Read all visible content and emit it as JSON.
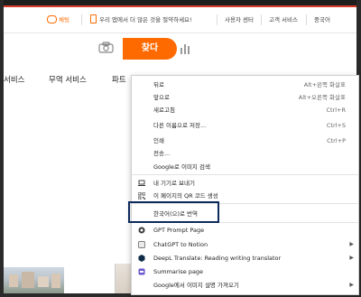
{
  "topbar": {
    "chat_label": "채팅",
    "promo_label": "우리 앱에서 더 많은 것을 절약하세요!",
    "seller_center": "사용자 센터",
    "customer_service": "고객 서비스",
    "language": "중국어"
  },
  "search": {
    "button_label": "찾다"
  },
  "nav": {
    "items": [
      "서비스",
      "무역 서비스",
      "파트"
    ]
  },
  "context_menu": {
    "items": [
      {
        "label": "뒤로",
        "shortcut": "Alt+왼쪽 화살표"
      },
      {
        "label": "앞으로",
        "shortcut": "Alt+오른쪽 화살표"
      },
      {
        "label": "새로고침",
        "shortcut": "Ctrl+R"
      },
      {
        "label": "다른 이름으로 저장...",
        "shortcut": "Ctrl+S"
      },
      {
        "label": "인쇄",
        "shortcut": "Ctrl+P"
      },
      {
        "label": "전송...",
        "shortcut": ""
      },
      {
        "label": "Google로 이미지 검색",
        "shortcut": ""
      },
      {
        "label": "내 기기로 보내기",
        "shortcut": ""
      },
      {
        "label": "이 페이지의 QR 코드 생성",
        "shortcut": ""
      },
      {
        "label": "한국어(으)로 번역",
        "shortcut": ""
      },
      {
        "label": "GPT Prompt Page",
        "shortcut": ""
      },
      {
        "label": "ChatGPT to Notion",
        "shortcut": ""
      },
      {
        "label": "DeepL Translate: Reading  writing translator",
        "shortcut": ""
      },
      {
        "label": "Summarise page",
        "shortcut": ""
      },
      {
        "label": "Google에서 이미지 설명 가져오기",
        "shortcut": ""
      }
    ]
  },
  "colors": {
    "accent": "#ff6a00",
    "top_strip": "#d93b2a",
    "highlight_border": "#0d2a5c"
  },
  "icons": [
    "chat-icon",
    "phone-icon",
    "camera-icon",
    "bar-chart-icon",
    "laptop-icon",
    "qr-code-icon",
    "gpt-icon",
    "chatgpt-notion-icon",
    "deepl-icon",
    "summarise-icon"
  ]
}
